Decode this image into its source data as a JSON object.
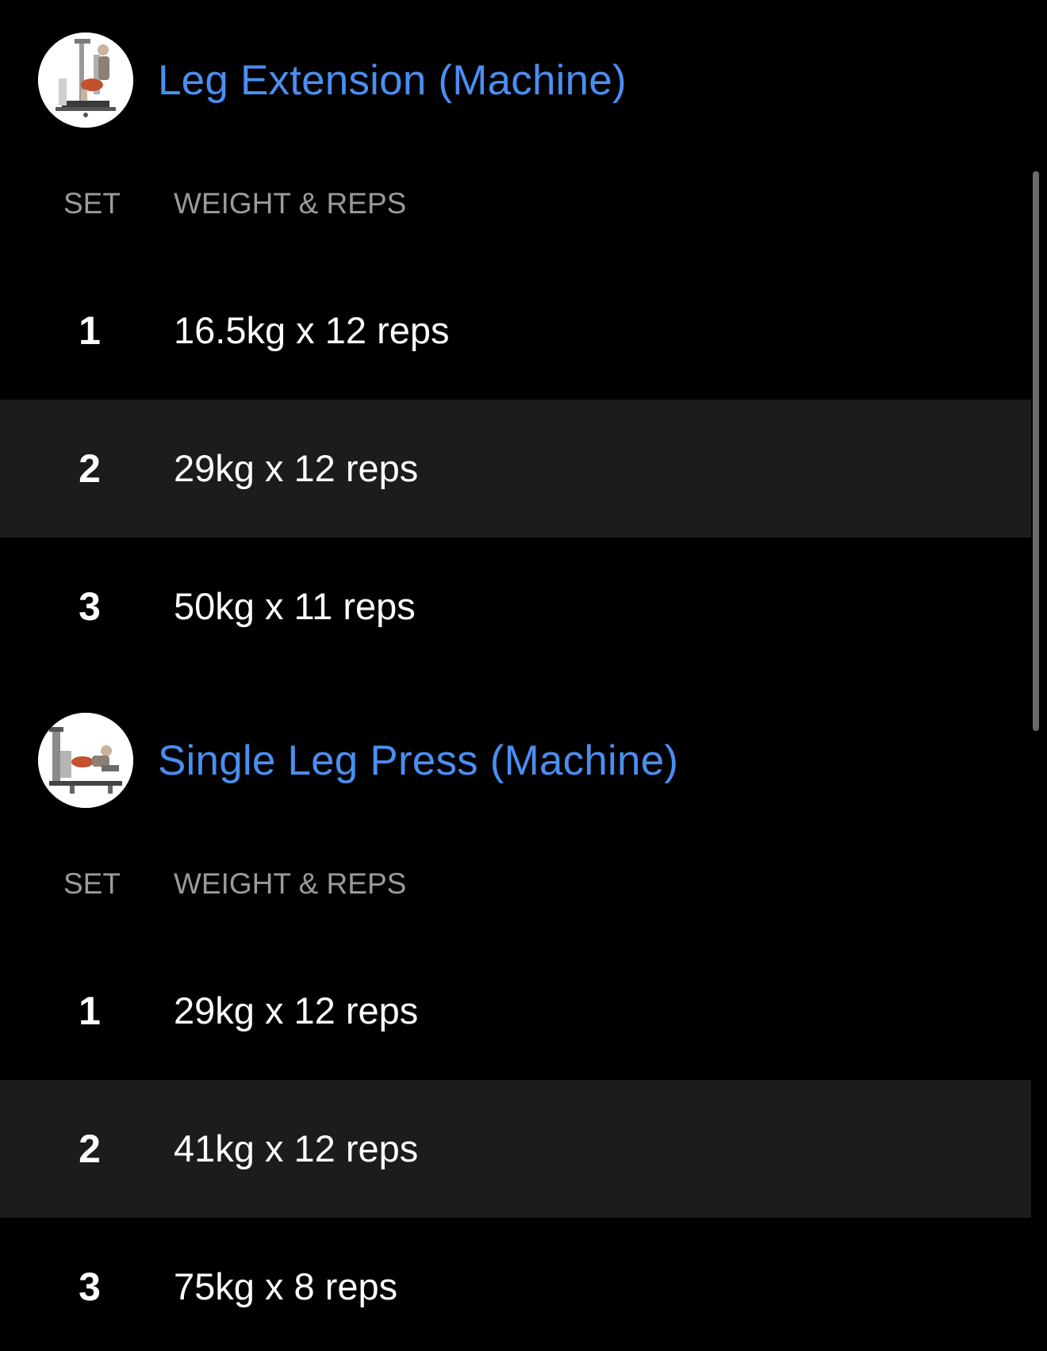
{
  "exercises": [
    {
      "title": "Leg Extension (Machine)",
      "thumbnail_icon": "leg-extension-machine-icon",
      "columns": {
        "set": "SET",
        "weight_reps": "WEIGHT & REPS"
      },
      "sets": [
        {
          "number": "1",
          "value": "16.5kg x 12 reps"
        },
        {
          "number": "2",
          "value": "29kg x 12 reps"
        },
        {
          "number": "3",
          "value": "50kg x 11 reps"
        }
      ]
    },
    {
      "title": "Single Leg Press (Machine)",
      "thumbnail_icon": "leg-press-machine-icon",
      "columns": {
        "set": "SET",
        "weight_reps": "WEIGHT & REPS"
      },
      "sets": [
        {
          "number": "1",
          "value": "29kg x 12 reps"
        },
        {
          "number": "2",
          "value": "41kg x 12 reps"
        },
        {
          "number": "3",
          "value": "75kg x 8 reps"
        }
      ]
    }
  ],
  "colors": {
    "background": "#000000",
    "accent_title": "#4a8ef0",
    "alt_row": "#1c1c1e",
    "column_header": "#9a9a9e",
    "scrollbar": "#6b6b6f"
  }
}
